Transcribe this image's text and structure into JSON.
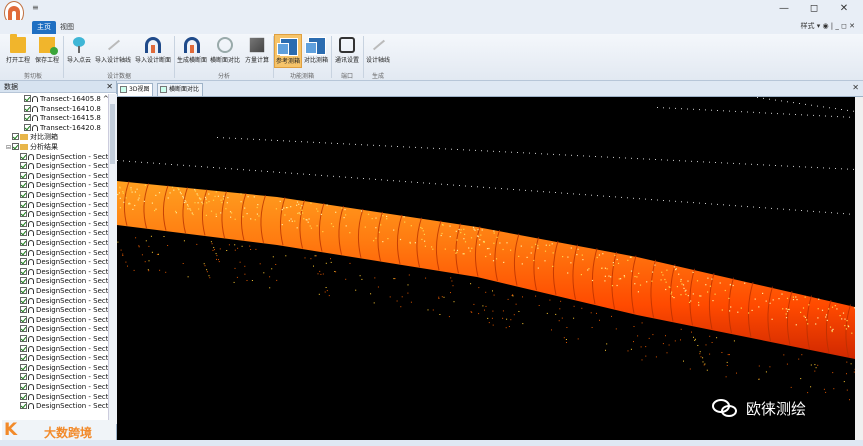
{
  "window": {
    "quick_access": "≡",
    "min": "—",
    "restore": "◻",
    "close": "✕",
    "style_menu": "样式 ▾ ◉ | _ ◻ ✕"
  },
  "ribbon_tabs": [
    {
      "label": "主页"
    },
    {
      "label": "视图"
    }
  ],
  "ribbon": {
    "buttons": [
      {
        "label": "打开工程"
      },
      {
        "label": "保存工程"
      },
      {
        "label": "导入点云"
      },
      {
        "label": "导入设计轴线"
      },
      {
        "label": "导入设计断面"
      },
      {
        "label": "生成横断面"
      },
      {
        "label": "横断面对比"
      },
      {
        "label": "方量计算"
      },
      {
        "label": "参考测箱"
      },
      {
        "label": "对比测箱"
      },
      {
        "label": "通讯设置"
      },
      {
        "label": "设计轴线"
      }
    ],
    "groups": [
      {
        "label": "剪切板"
      },
      {
        "label": "设计数据"
      },
      {
        "label": "分析"
      },
      {
        "label": "功能测箱"
      },
      {
        "label": "端口"
      },
      {
        "label": "生成"
      }
    ]
  },
  "panel": {
    "title": "数据",
    "close": "✕",
    "tree": [
      {
        "label": "Transect-16405.8",
        "suffix": "^"
      },
      {
        "label": "Transect-16410.8"
      },
      {
        "label": "Transect-16415.8"
      },
      {
        "label": "Transect-16420.8"
      },
      {
        "label": "对比测箱"
      },
      {
        "label": "分析结果"
      },
      {
        "label": "DesignSection - Sect"
      },
      {
        "label": "DesignSection - Sect"
      },
      {
        "label": "DesignSection - Sect"
      },
      {
        "label": "DesignSection - Sect"
      },
      {
        "label": "DesignSection - Sect"
      },
      {
        "label": "DesignSection - Sect"
      },
      {
        "label": "DesignSection - Sect"
      },
      {
        "label": "DesignSection - Sect"
      },
      {
        "label": "DesignSection - Sect"
      },
      {
        "label": "DesignSection - Sect"
      },
      {
        "label": "DesignSection - Sect"
      },
      {
        "label": "DesignSection - Sect"
      },
      {
        "label": "DesignSection - Sect"
      },
      {
        "label": "DesignSection - Sect"
      },
      {
        "label": "DesignSection - Sect"
      },
      {
        "label": "DesignSection - Sect"
      },
      {
        "label": "DesignSection - Sect"
      },
      {
        "label": "DesignSection - Sect"
      },
      {
        "label": "DesignSection - Sect"
      },
      {
        "label": "DesignSection - Sect"
      },
      {
        "label": "DesignSection - Sect"
      },
      {
        "label": "DesignSection - Sect"
      },
      {
        "label": "DesignSection - Sect"
      },
      {
        "label": "DesignSection - Sect"
      },
      {
        "label": "DesignSection - Sect"
      },
      {
        "label": "DesignSection - Sect"
      },
      {
        "label": "DesignSection - Sect"
      }
    ]
  },
  "logo": {
    "mark": "K",
    "text": "大数跨境"
  },
  "view_tabs": [
    {
      "label": "3D视图"
    },
    {
      "label": "横断面对比"
    }
  ],
  "view_close": "✕",
  "watermark": {
    "text": "欧徕测绘"
  },
  "colors": {
    "tunnel_hot": "#ff3c00",
    "tunnel_warm": "#ff8c1a",
    "tunnel_light": "#ffcc33",
    "ribbon_active": "#f6c46a",
    "tab_active": "#1f6fc2"
  }
}
